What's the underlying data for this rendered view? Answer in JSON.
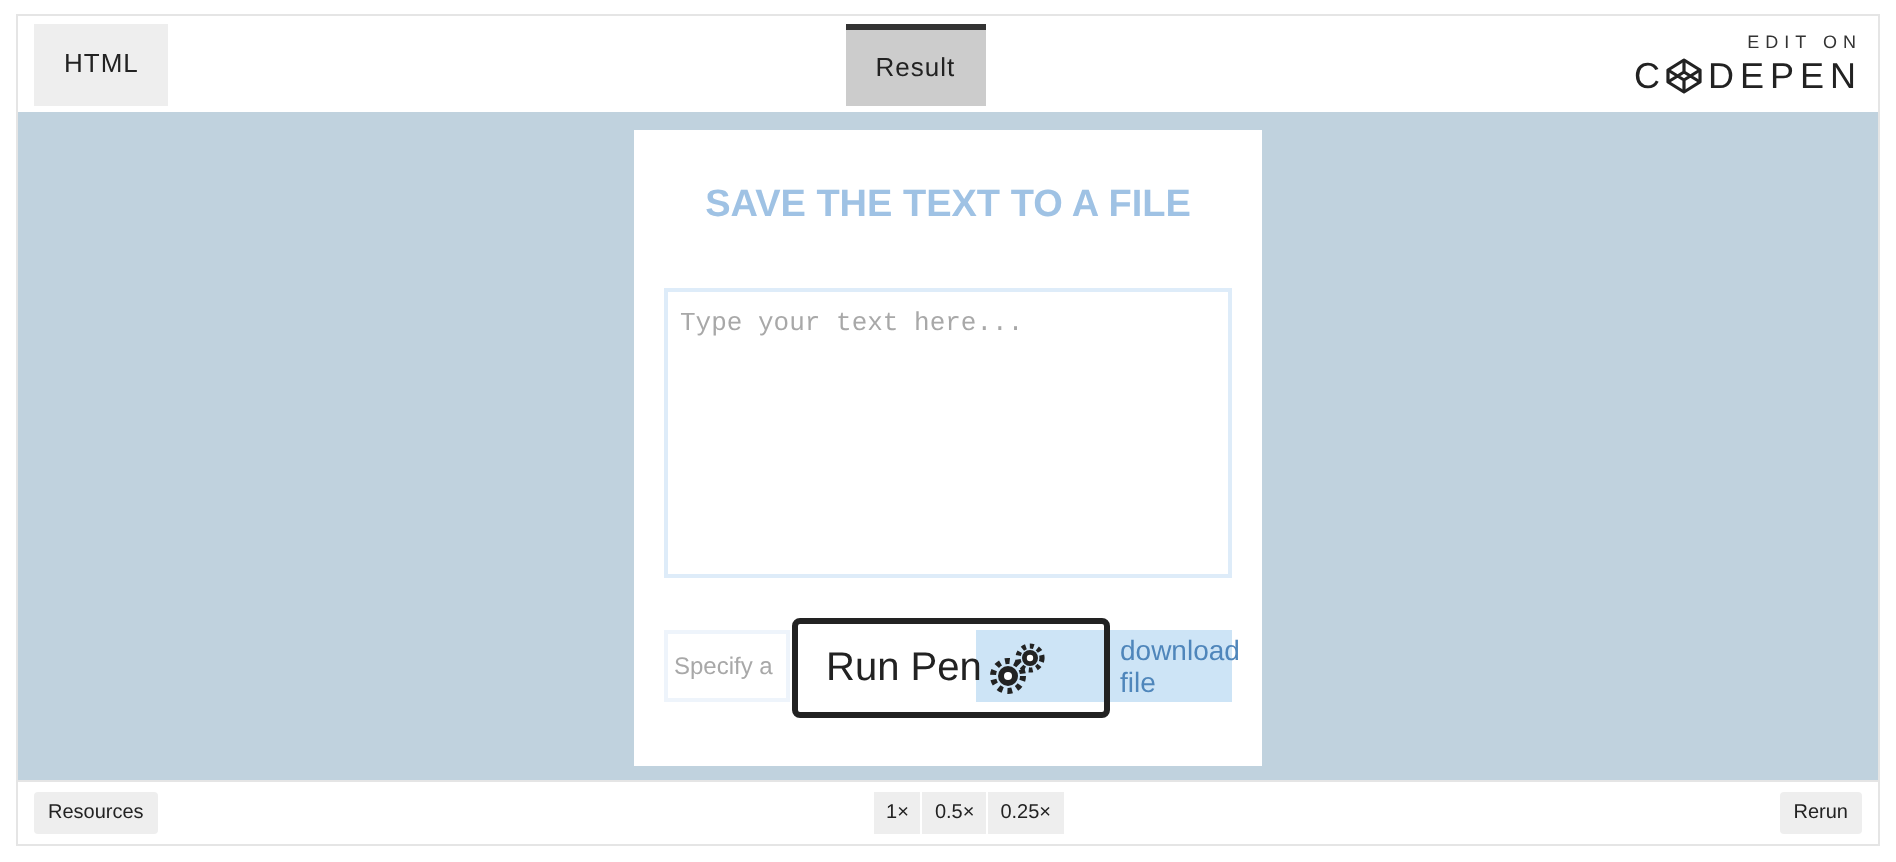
{
  "tabs": [
    {
      "label": "HTML",
      "selected": false
    },
    {
      "label": "Result",
      "selected": true
    }
  ],
  "logo": {
    "caption": "EDIT ON",
    "left": "C",
    "right": "DEPEN"
  },
  "result": {
    "heading": "SAVE THE TEXT TO A FILE",
    "text_placeholder": "Type your text here...",
    "filename_placeholder": "Specify a",
    "button": "download file"
  },
  "overlay": {
    "label": "Run Pen"
  },
  "footer": {
    "resources": "Resources",
    "zooms": [
      "1×",
      "0.5×",
      "0.25×"
    ],
    "rerun": "Rerun"
  }
}
